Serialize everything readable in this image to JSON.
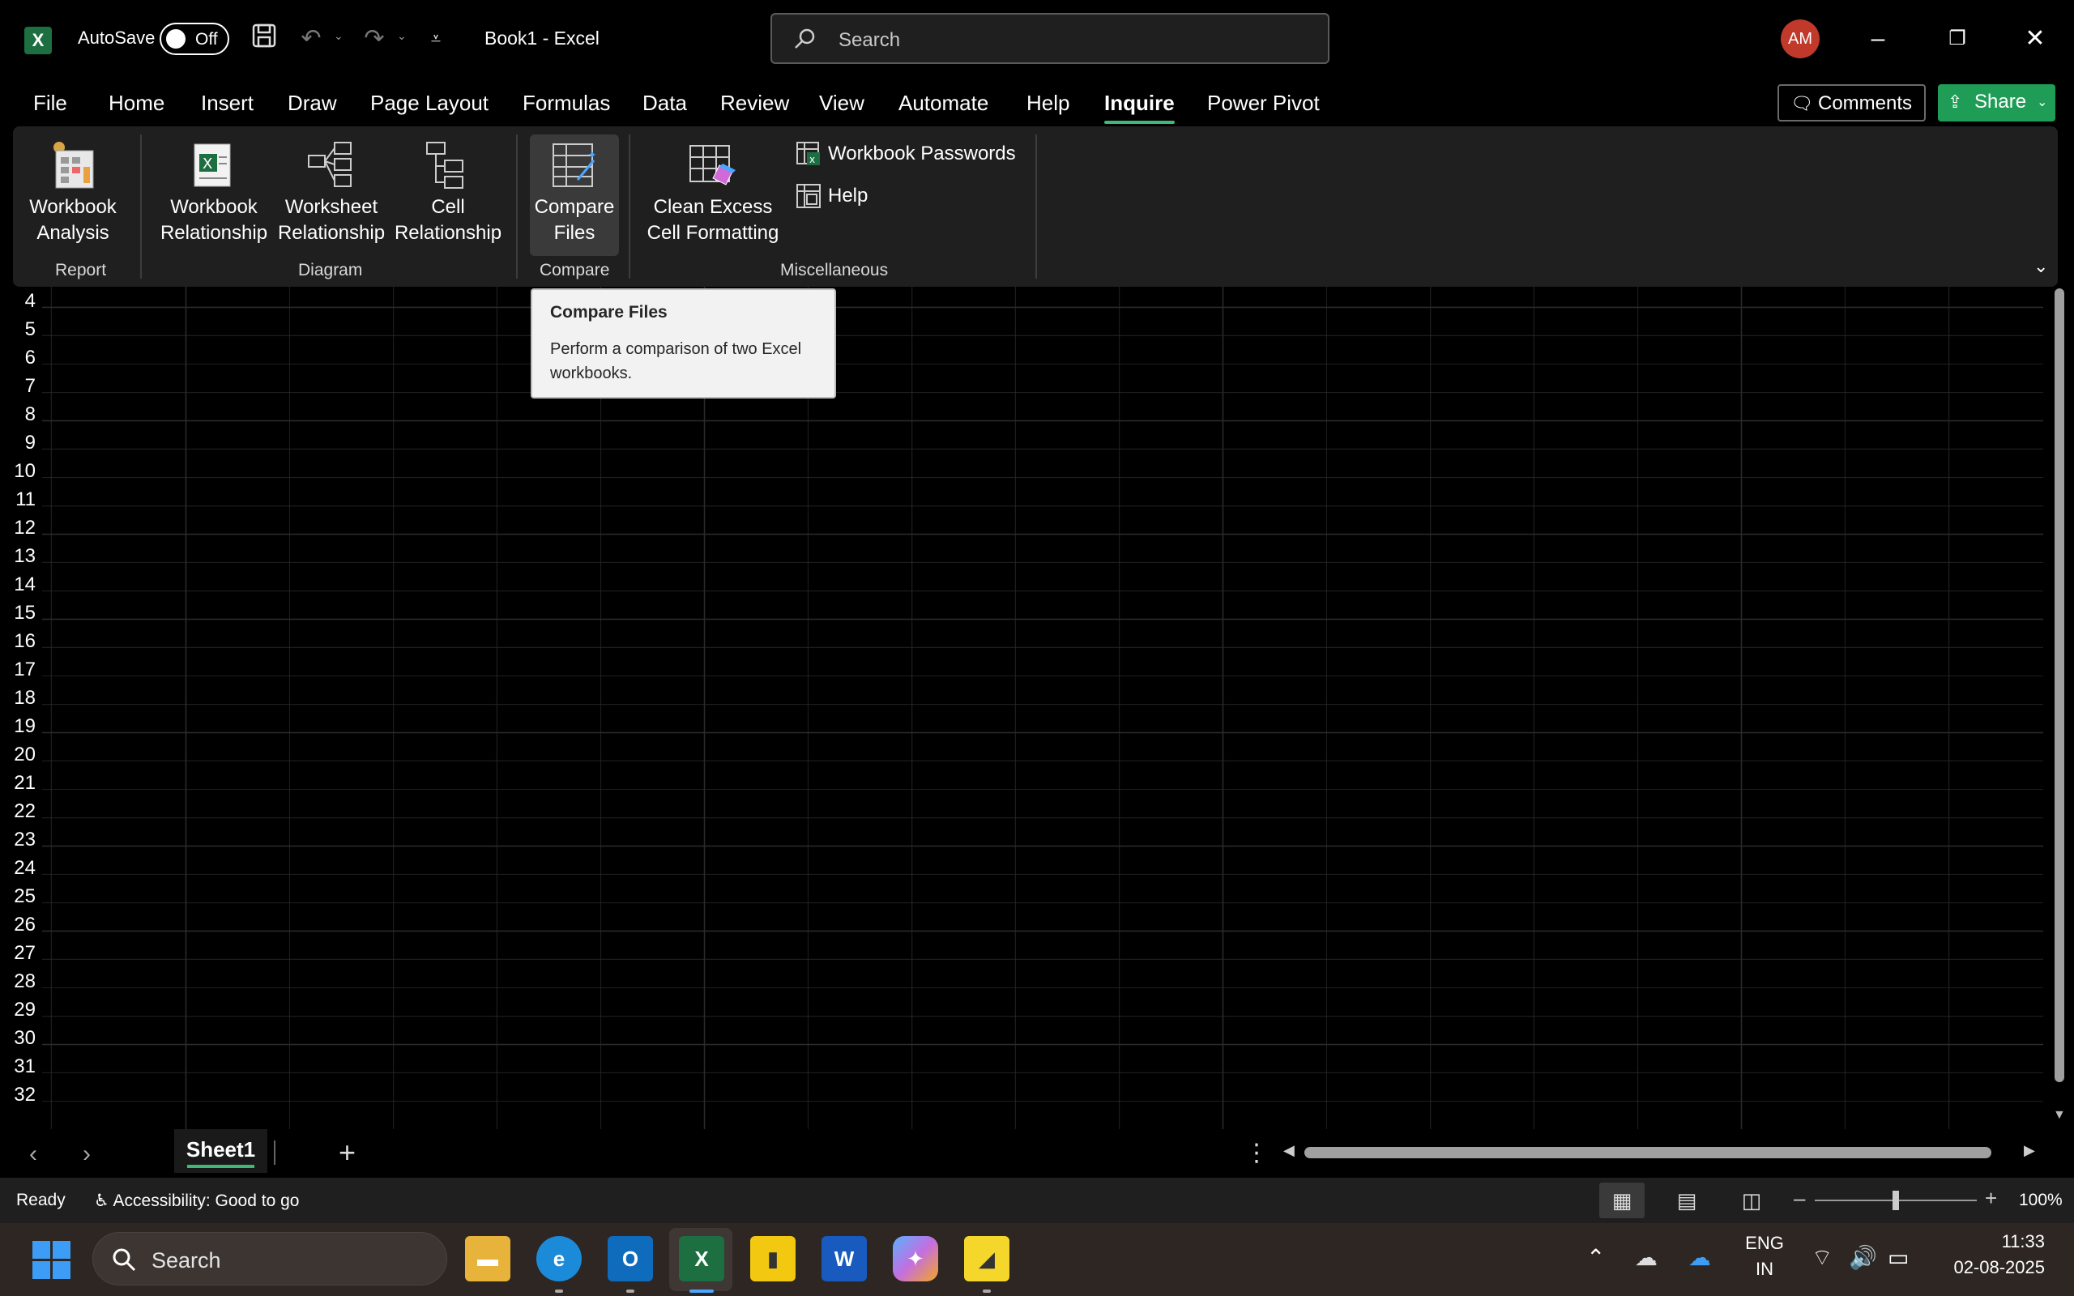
{
  "window": {
    "app_logo": "X",
    "autosave_label": "AutoSave",
    "autosave_state": "Off",
    "title": "Book1  -  Excel",
    "search_placeholder": "Search",
    "avatar_initials": "AM",
    "icons": [
      "save-icon",
      "undo-icon",
      "redo-icon",
      "customize-qat-icon",
      "minimize-icon",
      "restore-icon",
      "close-icon"
    ]
  },
  "tabs": {
    "items": [
      "File",
      "Home",
      "Insert",
      "Draw",
      "Page Layout",
      "Formulas",
      "Data",
      "Review",
      "View",
      "Automate",
      "Help",
      "Inquire",
      "Power Pivot"
    ],
    "active": "Inquire",
    "comments_label": "Comments",
    "share_label": "Share"
  },
  "ribbon": {
    "buttons": {
      "workbook_analysis": [
        "Workbook",
        "Analysis"
      ],
      "workbook_relationship": [
        "Workbook",
        "Relationship"
      ],
      "worksheet_relationship": [
        "Worksheet",
        "Relationship"
      ],
      "cell_relationship": [
        "Cell",
        "Relationship"
      ],
      "compare_files": [
        "Compare",
        "Files"
      ],
      "clean_excess": [
        "Clean Excess",
        "Cell Formatting"
      ],
      "workbook_passwords": "Workbook Passwords",
      "help": "Help"
    },
    "groups": {
      "report": "Report",
      "diagram": "Diagram",
      "compare": "Compare",
      "miscellaneous": "Miscellaneous"
    }
  },
  "tooltip": {
    "title": "Compare Files",
    "body": "Perform a comparison of two Excel workbooks."
  },
  "sheet": {
    "row_numbers": [
      "4",
      "5",
      "6",
      "7",
      "8",
      "9",
      "10",
      "11",
      "12",
      "13",
      "14",
      "15",
      "16",
      "17",
      "18",
      "19",
      "20",
      "21",
      "22",
      "23",
      "24",
      "25",
      "26",
      "27",
      "28",
      "29",
      "30",
      "31",
      "32"
    ],
    "tabs": [
      "Sheet1"
    ],
    "active_tab": "Sheet1"
  },
  "status": {
    "ready": "Ready",
    "accessibility": "Accessibility: Good to go",
    "zoom": "100%",
    "zoom_level_percent": 100
  },
  "taskbar": {
    "search_placeholder": "Search",
    "apps": [
      "file-explorer",
      "edge",
      "outlook",
      "excel",
      "power-bi",
      "word",
      "copilot",
      "sticky-notes"
    ],
    "active_app": "excel",
    "language": [
      "ENG",
      "IN"
    ],
    "time": "11:33",
    "date": "02-08-2025"
  },
  "colors": {
    "accent_green": "#3fb879",
    "share_green": "#1f9d56",
    "avatar_red": "#c0392b",
    "ribbon_bg": "#1f1f1f"
  }
}
